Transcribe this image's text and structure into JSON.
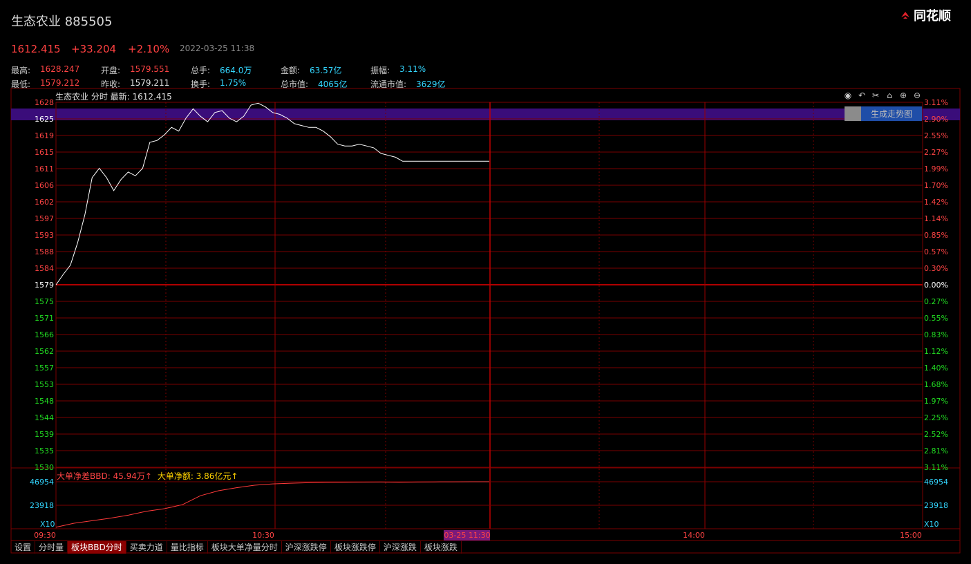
{
  "header": {
    "title": "生态农业 885505",
    "logo_text": "同花顺"
  },
  "quote": {
    "price": "1612.415",
    "change": "+33.204",
    "change_pct": "+2.10%",
    "datetime": "2022-03-25 11:38"
  },
  "stats": [
    {
      "label": "最高:",
      "value": "1628.247",
      "color": "red"
    },
    {
      "label": "开盘:",
      "value": "1579.551",
      "color": "red"
    },
    {
      "label": "总手:",
      "value": "664.0万",
      "color": "cyan"
    },
    {
      "label": "金额:",
      "value": "63.57亿",
      "color": "cyan"
    },
    {
      "label": "振幅:",
      "value": "3.11%",
      "color": "cyan"
    },
    {
      "label": "最低:",
      "value": "1579.212",
      "color": "red"
    },
    {
      "label": "昨收:",
      "value": "1579.211",
      "color": "white"
    },
    {
      "label": "换手:",
      "value": "1.75%",
      "color": "cyan"
    },
    {
      "label": "总市值:",
      "value": "4065亿",
      "color": "cyan"
    },
    {
      "label": "流通市值:",
      "value": "3629亿",
      "color": "cyan"
    }
  ],
  "chart_header": "生态农业 分时 最新: 1612.415",
  "toolbar_icons": [
    "eye-icon",
    "undo-icon",
    "scissors-icon",
    "lock-icon",
    "zoom-in-icon",
    "zoom-out-icon"
  ],
  "generate_button": "生成走势图",
  "bbd_legend": {
    "bbd": "大单净差BBD: 45.94万↑",
    "amount": "大单净额: 3.86亿元↑"
  },
  "tabs": [
    {
      "label": "设置",
      "active": false
    },
    {
      "label": "分时量",
      "active": false
    },
    {
      "label": "板块BBD分时",
      "active": true
    },
    {
      "label": "买卖力道",
      "active": false
    },
    {
      "label": "量比指标",
      "active": false
    },
    {
      "label": "板块大单净量分时",
      "active": false
    },
    {
      "label": "沪深涨跌停",
      "active": false
    },
    {
      "label": "板块涨跌停",
      "active": false
    },
    {
      "label": "沪深涨跌",
      "active": false
    },
    {
      "label": "板块涨跌",
      "active": false
    }
  ],
  "colors": {
    "up": "#ff4444",
    "down": "#22dd22",
    "grid": "#7a0000",
    "price_line": "#ffffff",
    "bbd_line": "#ff3a3a",
    "crosshair_band": "#3a0d7a",
    "time_badge": "#7a1a7a"
  },
  "chart_data": [
    {
      "type": "line",
      "name": "intraday-price",
      "prev_close": 1579.211,
      "ylim": [
        1530,
        1628
      ],
      "left_ticks_up": [
        "1628",
        "1625",
        "1619",
        "1615",
        "1611",
        "1606",
        "1602",
        "1597",
        "1593",
        "1588",
        "1584"
      ],
      "left_tick_mid": "1579",
      "left_ticks_down": [
        "1575",
        "1571",
        "1566",
        "1562",
        "1557",
        "1553",
        "1548",
        "1544",
        "1539",
        "1535",
        "1530"
      ],
      "right_ticks_up": [
        "3.11%",
        "2.90%",
        "2.55%",
        "2.27%",
        "1.99%",
        "1.70%",
        "1.42%",
        "1.14%",
        "0.85%",
        "0.57%",
        "0.30%"
      ],
      "right_tick_mid": "0.00%",
      "right_ticks_down": [
        "0.27%",
        "0.55%",
        "0.83%",
        "1.12%",
        "1.40%",
        "1.68%",
        "1.97%",
        "2.25%",
        "2.52%",
        "2.81%",
        "3.11%"
      ],
      "x_ticks": [
        "09:30",
        "10:30",
        "03-25 11:30",
        "14:00",
        "15:00"
      ],
      "series": [
        {
          "minutes": [
            0,
            2,
            4,
            6,
            8,
            10,
            12,
            14,
            16,
            18,
            20,
            22,
            24,
            26,
            28,
            30,
            32,
            34,
            36,
            38,
            40,
            42,
            44,
            46,
            48,
            50,
            52,
            54,
            56,
            58,
            60,
            62,
            64,
            66,
            68,
            70,
            72,
            74,
            76,
            78,
            80,
            82,
            84,
            86,
            88,
            90,
            92,
            94,
            96,
            98,
            100,
            102,
            104,
            106,
            108,
            110,
            112,
            114,
            116,
            118,
            120
          ],
          "values": [
            1579.2,
            1582.0,
            1584.5,
            1590.5,
            1598.0,
            1608.0,
            1610.5,
            1608.0,
            1604.5,
            1607.5,
            1609.5,
            1608.5,
            1610.5,
            1617.5,
            1618.0,
            1619.5,
            1621.5,
            1620.5,
            1624.0,
            1626.5,
            1624.5,
            1623.0,
            1625.5,
            1626.0,
            1624.0,
            1623.0,
            1624.5,
            1627.5,
            1628.0,
            1627.0,
            1625.5,
            1625.0,
            1624.0,
            1622.5,
            1622.0,
            1621.5,
            1621.5,
            1620.5,
            1619.0,
            1617.0,
            1616.5,
            1616.5,
            1617.0,
            1616.5,
            1616.0,
            1614.5,
            1614.0,
            1613.5,
            1612.4,
            1612.4,
            1612.4,
            1612.4,
            1612.4,
            1612.4,
            1612.4,
            1612.4,
            1612.4,
            1612.4,
            1612.4,
            1612.4,
            1612.4
          ]
        }
      ]
    },
    {
      "type": "line",
      "name": "bbd",
      "ylim": [
        0,
        46954
      ],
      "left_ticks": [
        "46954",
        "23918"
      ],
      "right_ticks": [
        "46954",
        "23918"
      ],
      "scale_label": "X10",
      "series": [
        {
          "minutes": [
            0,
            5,
            10,
            15,
            20,
            25,
            30,
            35,
            40,
            45,
            50,
            55,
            60,
            65,
            70,
            75,
            80,
            85,
            90,
            95,
            100,
            105,
            110,
            115,
            120
          ],
          "values": [
            1500,
            5500,
            8000,
            10500,
            13500,
            17500,
            20000,
            24000,
            33000,
            38000,
            41000,
            43500,
            44800,
            45500,
            46000,
            46300,
            46500,
            46600,
            46700,
            46500,
            46700,
            46800,
            46900,
            46950,
            46954
          ]
        }
      ]
    }
  ]
}
